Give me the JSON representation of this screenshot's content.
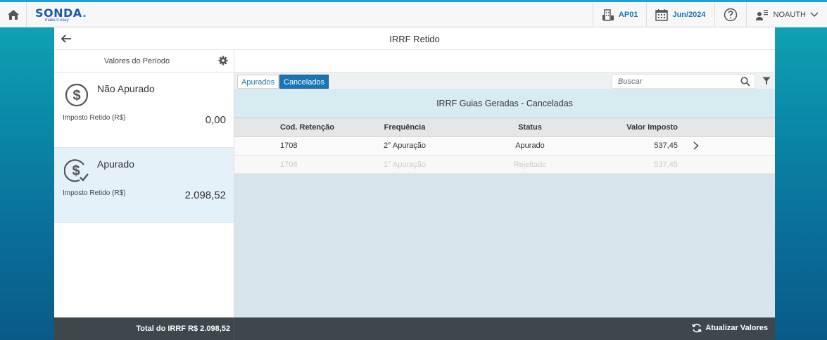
{
  "topbar": {
    "logo_main": "SONDA",
    "logo_dot": ".",
    "logo_sub": "make it easy",
    "company": "AP01",
    "period": "Jun/2024",
    "user": "NOAUTH",
    "icons": [
      "home-icon",
      "building-icon",
      "calendar-icon",
      "help-icon",
      "user-icon",
      "chevron-down-icon"
    ]
  },
  "page": {
    "title": "IRRF Retido"
  },
  "left_panel": {
    "header": "Valores do Período",
    "cards": [
      {
        "title": "Não Apurado",
        "label": "Imposto Retido (R$)",
        "value": "0,00"
      },
      {
        "title": "Apurado",
        "label": "Imposto Retido (R$)",
        "value": "2.098,52"
      }
    ]
  },
  "toolbar": {
    "tabs": [
      "Apurados",
      "Cancelados"
    ],
    "active_tab": "Cancelados",
    "search_placeholder": "Buscar"
  },
  "table": {
    "title": "IRRF Guias Geradas - Canceladas",
    "columns": [
      "Cod. Retenção",
      "Frequência",
      "Status",
      "Valor Imposto"
    ],
    "rows": [
      [
        "1708",
        "2° Apuração",
        "Apurado",
        "537,45"
      ],
      [
        "1708",
        "1° Apuração",
        "Rejeitado",
        "537,45"
      ]
    ]
  },
  "footer": {
    "total_label": "Total do IRRF  R$ 2.098,52",
    "refresh_label": "Atualizar Valores"
  },
  "colors": {
    "accent": "#1a75b5",
    "topbar_border": "#1aa3d8",
    "footer_bg": "#3d474c",
    "active_card": "#e4f1f8"
  }
}
